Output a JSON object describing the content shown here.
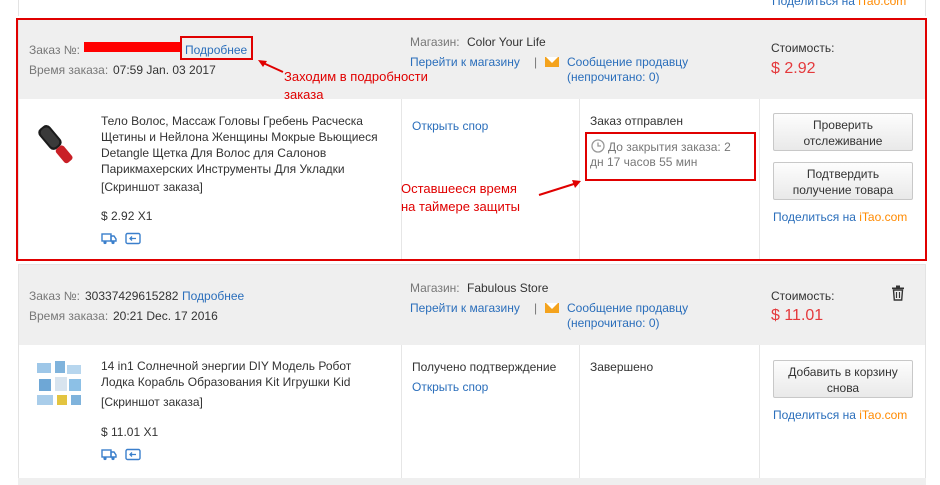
{
  "top": {
    "share_prefix": "Поделиться на ",
    "share_brand": "iTao.com"
  },
  "orders": [
    {
      "order_no_label": "Заказ №:",
      "order_no_value": "",
      "details_label": "Подробнее",
      "time_label": "Время заказа:",
      "time_value": "07:59 Jan. 03 2017",
      "store_label": "Магазин:",
      "store_name": "Color Your Life",
      "goto_store": "Перейти к магазину",
      "separator": "|",
      "message_seller": "Сообщение продавцу",
      "unread_prefix": "(непрочитано: ",
      "unread_count": "0",
      "unread_suffix": ")",
      "cost_label": "Стоимость:",
      "cost_value": "$ 2.92",
      "product_title": "Тело Волос, Массаж Головы Гребень Расческа Щетины и Нейлона Женщины Мокрые Вьющиеся Detangle Щетка Для Волос для Салонов Парикмахерских Инструменты Для Укладки",
      "snapshot": "[Скриншот заказа]",
      "product_price": "$ 2.92 X1",
      "action_link": "Открыть спор",
      "status": "Заказ отправлен",
      "timer_text_1": "До закрытия заказа: 2",
      "timer_text_2": "дн 17 часов 55 мин",
      "btn1": "Проверить отслеживание",
      "btn2": "Подтвердить получение товара",
      "share_prefix": "Поделиться на ",
      "share_brand": "iTao.com"
    },
    {
      "order_no_label": "Заказ №:",
      "order_no_value": "30337429615282",
      "details_label": "Подробнее",
      "time_label": "Время заказа:",
      "time_value": "20:21 Dec. 17 2016",
      "store_label": "Магазин:",
      "store_name": "Fabulous Store",
      "goto_store": "Перейти к магазину",
      "separator": "|",
      "message_seller": "Сообщение продавцу",
      "unread_prefix": "(непрочитано: ",
      "unread_count": "0",
      "unread_suffix": ")",
      "cost_label": "Стоимость:",
      "cost_value": "$ 11.01",
      "product_title_1": "14 in1 Солнечной энергии DIY Модель Робот",
      "product_title_2": "Лодка Корабль Образования Kit Игрушки Kid",
      "snapshot": "[Скриншот заказа]",
      "product_price": "$ 11.01 X1",
      "confirm_status": "Получено подтверждение",
      "action_link": "Открыть спор",
      "status": "Завершено",
      "btn1": "Добавить в корзину снова",
      "share_prefix": "Поделиться на ",
      "share_brand": "iTao.com"
    }
  ],
  "annotations": {
    "details_note_1": "Заходим в подробности",
    "details_note_2": "заказа",
    "timer_note_1": "Оставшееся время",
    "timer_note_2": "на  таймере защиты"
  },
  "colors": {
    "link": "#2a6ebb",
    "price": "#e4393c",
    "annotation": "#e00000",
    "header_bg": "#efefef",
    "brand": "#ff8a00"
  }
}
